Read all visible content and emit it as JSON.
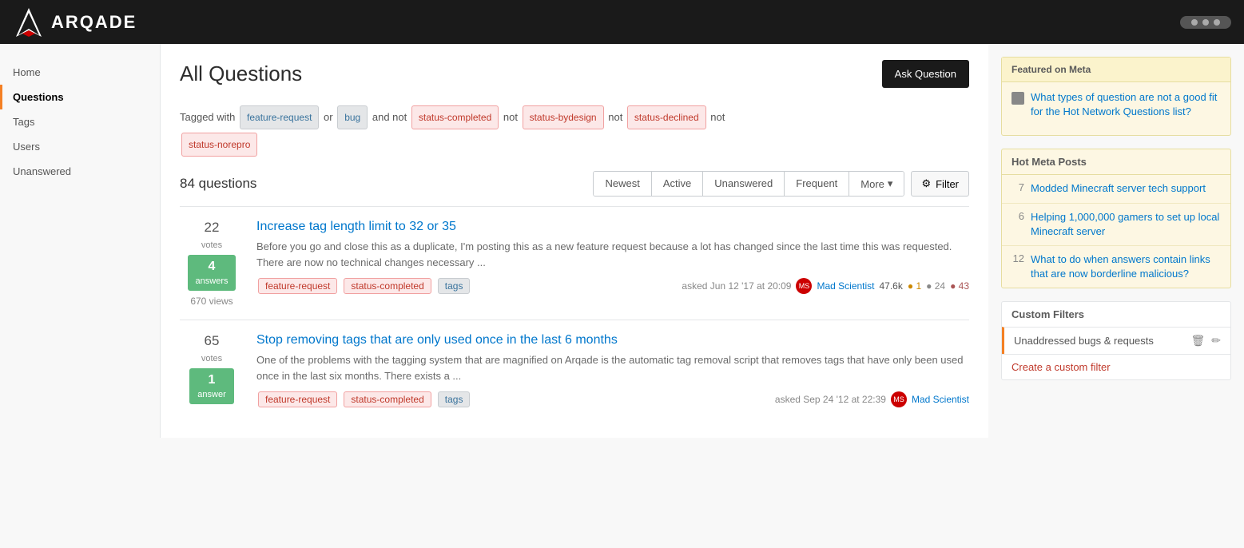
{
  "header": {
    "logo_text": "ARQADE",
    "pill_dots": 3
  },
  "sidebar": {
    "items": [
      {
        "label": "Home",
        "id": "home",
        "active": false
      },
      {
        "label": "Questions",
        "id": "questions",
        "active": true
      },
      {
        "label": "Tags",
        "id": "tags",
        "active": false
      },
      {
        "label": "Users",
        "id": "users",
        "active": false
      },
      {
        "label": "Unanswered",
        "id": "unanswered",
        "active": false
      }
    ]
  },
  "main": {
    "page_title": "All Questions",
    "ask_button": "Ask Question",
    "filter_row": {
      "prefix": "Tagged with",
      "tags": [
        {
          "label": "feature-request",
          "type": "gray"
        },
        {
          "label": "bug",
          "type": "gray"
        }
      ],
      "and_not_tags": [
        {
          "label": "status-completed",
          "type": "red"
        },
        {
          "label": "status-bydesign",
          "type": "red"
        },
        {
          "label": "status-declined",
          "type": "red"
        }
      ],
      "last_not_tag": {
        "label": "status-norepro",
        "type": "red"
      },
      "connector1": "or",
      "connector2": "and not",
      "connector3": "not",
      "connector4": "not",
      "connector5": "not"
    },
    "questions_count": "84 questions",
    "tabs": [
      {
        "label": "Newest",
        "active": false
      },
      {
        "label": "Active",
        "active": false
      },
      {
        "label": "Unanswered",
        "active": false
      },
      {
        "label": "Frequent",
        "active": false
      },
      {
        "label": "More",
        "active": false,
        "has_arrow": true
      }
    ],
    "filter_button": "Filter",
    "questions": [
      {
        "id": "q1",
        "votes": "22",
        "votes_label": "votes",
        "answers": "4",
        "answers_label": "answers",
        "answered": true,
        "views": "670 views",
        "title": "Increase tag length limit to 32 or 35",
        "excerpt": "Before you go and close this as a duplicate, I'm posting this as a new feature request because a lot has changed since the last time this was requested. There are now no technical changes necessary ...",
        "tags": [
          "feature-request",
          "status-completed",
          "tags"
        ],
        "tag_types": [
          "red",
          "red",
          "gray"
        ],
        "asked_info": "asked Jun 12 '17 at 20:09",
        "user": "Mad Scientist",
        "rep": "47.6k",
        "gold": 1,
        "silver": 24,
        "bronze": 43
      },
      {
        "id": "q2",
        "votes": "65",
        "votes_label": "votes",
        "answers": "1",
        "answers_label": "answer",
        "answered": true,
        "views": "...",
        "title": "Stop removing tags that are only used once in the last 6 months",
        "excerpt": "One of the problems with the tagging system that are magnified on Arqade is the automatic tag removal script that removes tags that have only been used once in the last six months. There exists a ...",
        "tags": [
          "feature-request",
          "status-completed",
          "tags"
        ],
        "tag_types": [
          "red",
          "red",
          "gray"
        ],
        "asked_info": "asked Sep 24 '12 at 22:39",
        "user": "Mad Scientist",
        "rep": "",
        "gold": 0,
        "silver": 0,
        "bronze": 0
      }
    ]
  },
  "right_sidebar": {
    "featured_meta": {
      "header": "Featured on Meta",
      "items": [
        {
          "text": "What types of question are not a good fit for the Hot Network Questions list?",
          "icon": "meta-icon"
        }
      ]
    },
    "hot_meta": {
      "header": "Hot Meta Posts",
      "items": [
        {
          "num": "7",
          "text": "Modded Minecraft server tech support"
        },
        {
          "num": "6",
          "text": "Helping 1,000,000 gamers to set up local Minecraft server"
        },
        {
          "num": "12",
          "text": "What to do when answers contain links that are now borderline malicious?"
        }
      ]
    },
    "custom_filters": {
      "header": "Custom Filters",
      "items": [
        {
          "label": "Unaddressed bugs & requests"
        }
      ],
      "create_link": "Create a custom filter"
    }
  }
}
